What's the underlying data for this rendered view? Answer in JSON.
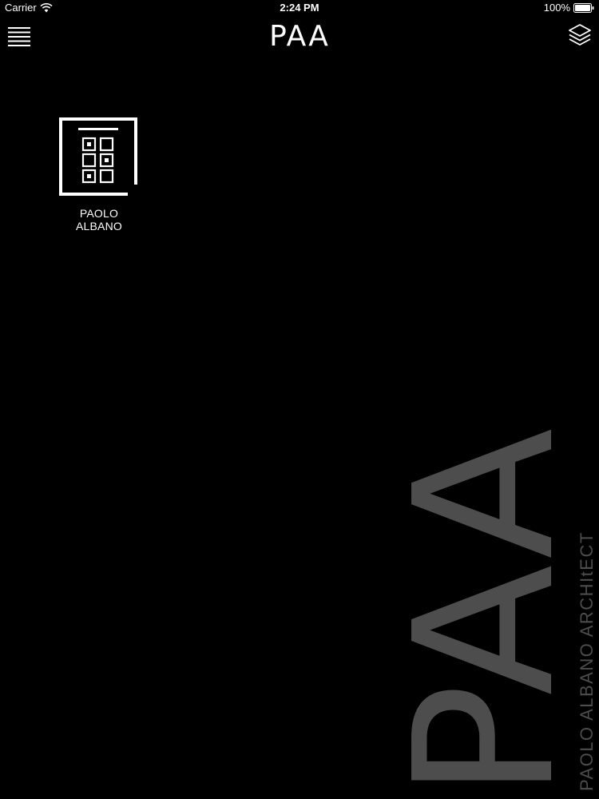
{
  "status_bar": {
    "carrier": "Carrier",
    "time": "2:24 PM",
    "battery": "100%"
  },
  "nav": {
    "logo_text": "PAA",
    "menu_icon": "hamburger-menu-icon",
    "layers_icon": "layers-icon"
  },
  "projects": [
    {
      "label": "PAOLO ALBANO",
      "icon": "building-facade-icon"
    }
  ],
  "watermark": {
    "logo_text": "PAA",
    "text": "PAOLO ALBANO ARCHItECT"
  },
  "colors": {
    "background": "#000000",
    "foreground": "#ffffff",
    "watermark": "#4d4d4d"
  }
}
